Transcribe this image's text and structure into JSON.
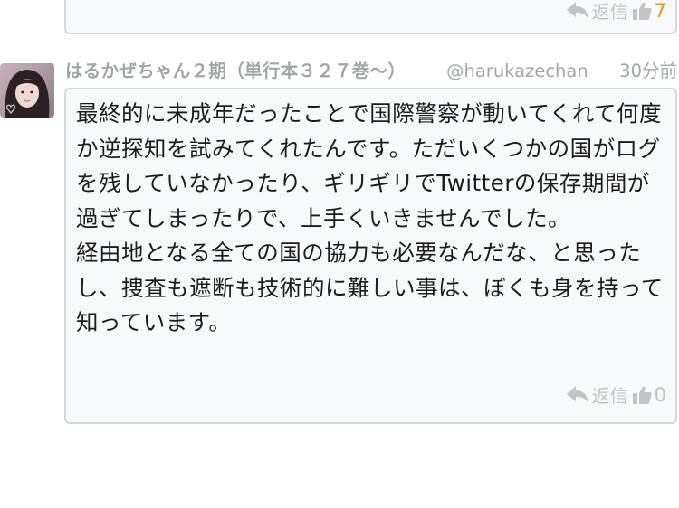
{
  "previous_post": {
    "reply_label": "返信",
    "like_count": "7"
  },
  "post": {
    "display_name": "はるかぜちゃん２期（単行本３２７巻〜）",
    "handle": "@harukazechan",
    "time": "30分前",
    "body": "最終的に未成年だったことで国際警察が動いてくれて何度か逆探知を試みてくれたんです。ただいくつかの国がログを残していなかったり、ギリギリでTwitterの保存期間が過ぎてしまったりで、上手くいきませんでした。\n経由地となる全ての国の協力も必要なんだな、と思ったし、捜査も遮断も技術的に難しい事は、ぼくも身を持って知っています。",
    "reply_label": "返信",
    "like_count": "0"
  },
  "icons": {
    "reply": "reply-arrow-icon",
    "like": "thumbs-up-icon"
  },
  "colors": {
    "action_gray": "#c2c5c8",
    "like_count_highlight": "#e8952b",
    "card_border": "#d6d9dc",
    "card_background": "#f7f9fb"
  }
}
